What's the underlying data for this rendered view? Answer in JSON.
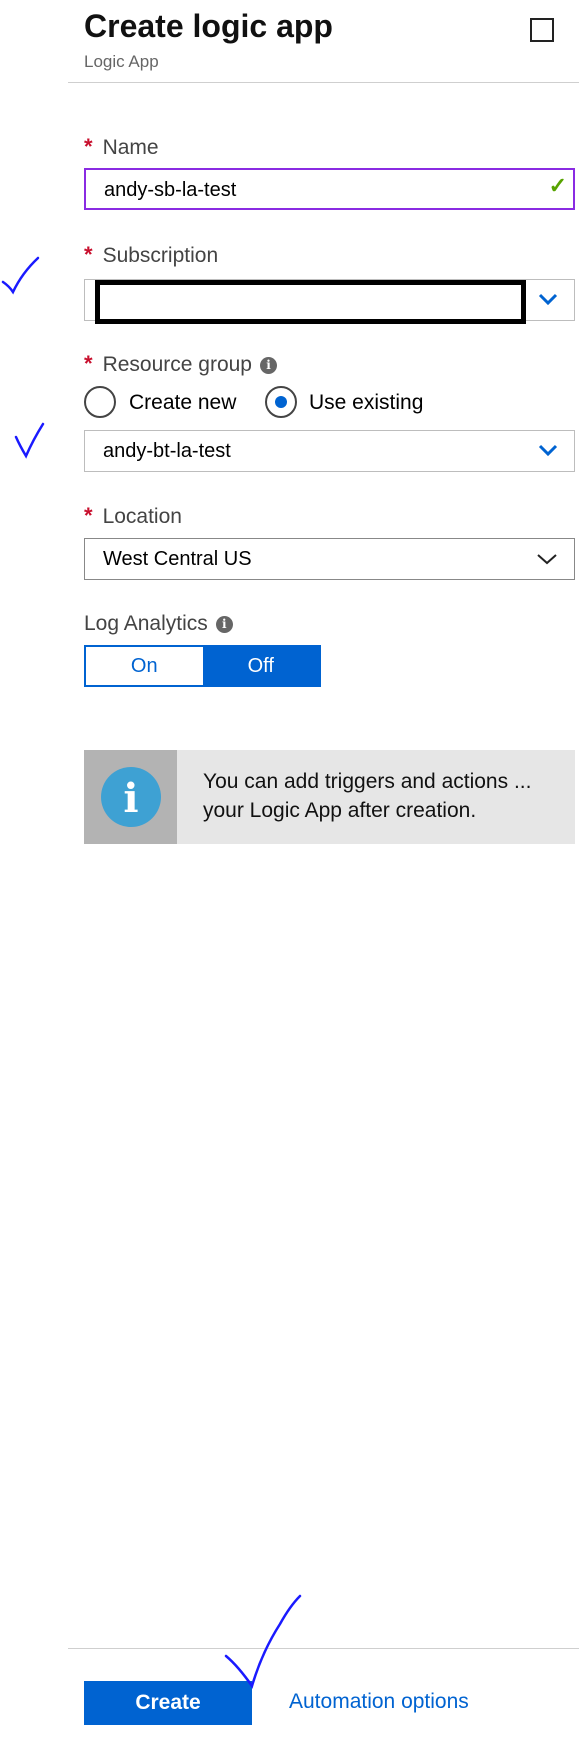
{
  "header": {
    "title": "Create logic app",
    "subtitle": "Logic App"
  },
  "name": {
    "label": "Name",
    "value": "andy-sb-la-test"
  },
  "subscription": {
    "label": "Subscription",
    "value": ""
  },
  "resource_group": {
    "label": "Resource group",
    "options": [
      "Create new",
      "Use existing"
    ],
    "selected": "Use existing",
    "value": "andy-bt-la-test"
  },
  "location": {
    "label": "Location",
    "value": "West Central US"
  },
  "log_analytics": {
    "label": "Log Analytics",
    "on_label": "On",
    "off_label": "Off",
    "selected": "Off"
  },
  "info_message": {
    "text": "You can add triggers and actions ... your Logic App after creation."
  },
  "footer": {
    "create_label": "Create",
    "automation_label": "Automation options"
  },
  "required_marker": "*",
  "icons": {
    "valid": "checkmark-icon",
    "dropdown": "chevron-down-icon",
    "info": "info-icon",
    "maximize": "maximize-icon"
  },
  "colors": {
    "accent": "#0063d1",
    "required": "#c8102e",
    "valid": "#57a300",
    "focus_border": "#8a2be2",
    "annotation": "#1a1aff"
  }
}
